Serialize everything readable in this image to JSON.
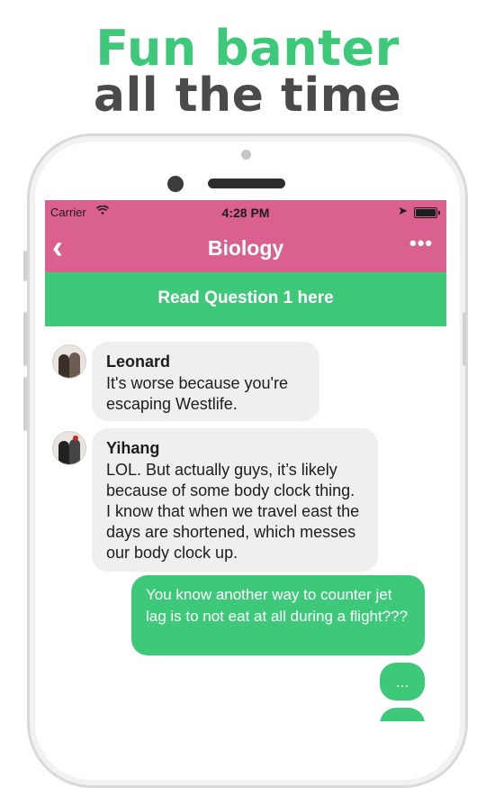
{
  "headline": {
    "line1": "Fun banter",
    "line2": "all the time"
  },
  "status_bar": {
    "carrier": "Carrier",
    "time": "4:28 PM"
  },
  "nav": {
    "title": "Biology",
    "back_icon": "chevron-left-icon",
    "more_icon": "ellipsis-icon"
  },
  "banner": {
    "label": "Read Question 1 here"
  },
  "messages": [
    {
      "sender": "Leonard",
      "text": "It's worse because you're escaping Westlife.",
      "direction": "incoming"
    },
    {
      "sender": "Yihang",
      "text": "LOL. But actually guys, it’s likely because of some body clock thing. I know that when we travel east the days are shortened, which messes our body clock up.",
      "direction": "incoming"
    },
    {
      "sender": "",
      "text": "You know another way to counter jet lag is to not eat at all during a flight???",
      "direction": "outgoing"
    },
    {
      "sender": "",
      "text": "...",
      "direction": "outgoing"
    }
  ],
  "colors": {
    "accent_green": "#3ec97a",
    "header_pink": "#d9608f",
    "bubble_grey": "#efefef"
  }
}
